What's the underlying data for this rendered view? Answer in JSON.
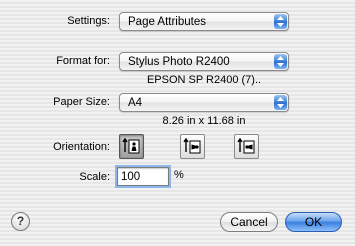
{
  "settings": {
    "label": "Settings:",
    "value": "Page Attributes"
  },
  "format_for": {
    "label": "Format for:",
    "value": "Stylus Photo R2400",
    "printer_info": "EPSON SP R2400 (7).."
  },
  "paper_size": {
    "label": "Paper Size:",
    "value": "A4",
    "dimensions": "8.26 in x 11.68 in"
  },
  "orientation": {
    "label": "Orientation:",
    "options": [
      {
        "name": "portrait",
        "selected": true
      },
      {
        "name": "landscape-left",
        "selected": false
      },
      {
        "name": "landscape-right",
        "selected": false
      }
    ]
  },
  "scale": {
    "label": "Scale:",
    "value": "100",
    "unit": "%"
  },
  "buttons": {
    "help": "?",
    "cancel": "Cancel",
    "ok": "OK"
  },
  "colors": {
    "accent": "#3a7fe0",
    "background": "#ececec"
  }
}
